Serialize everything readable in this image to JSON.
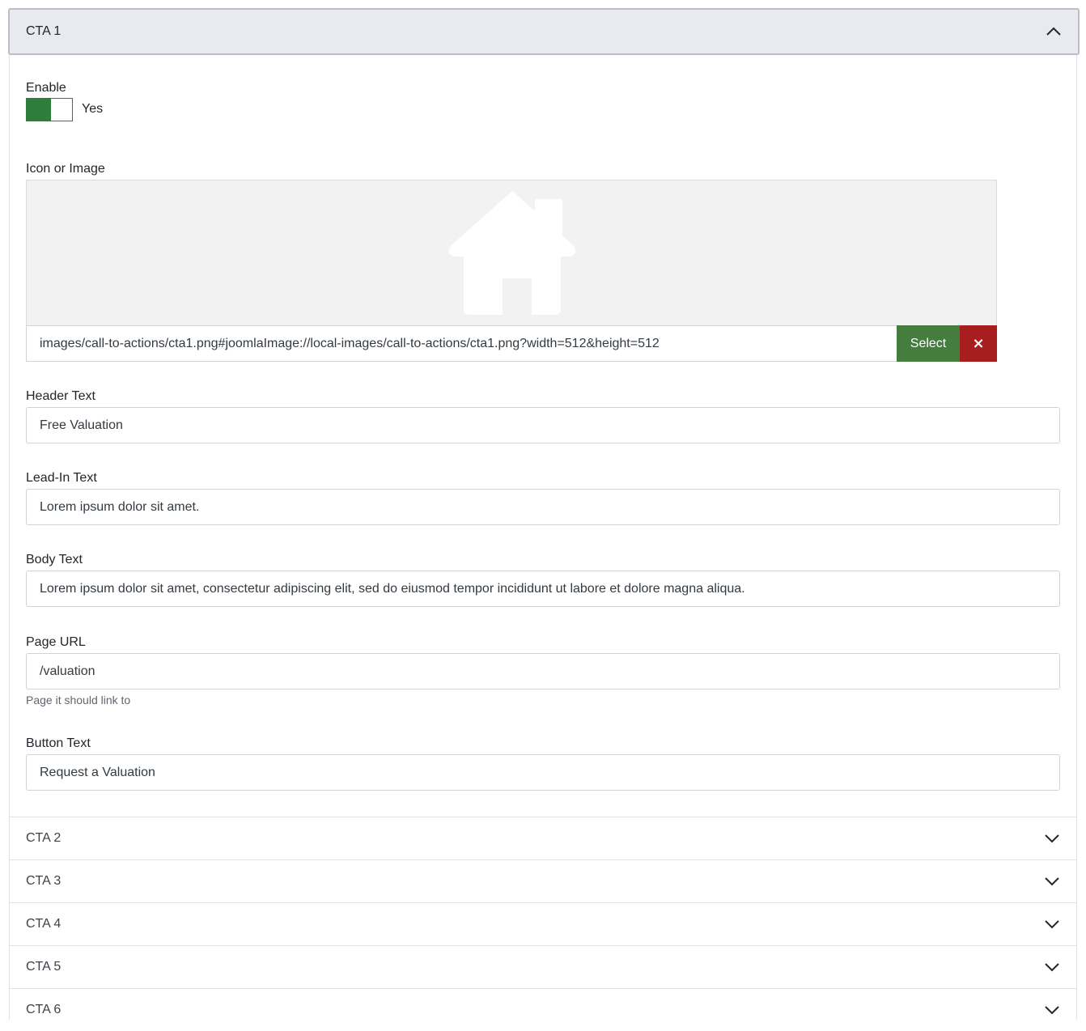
{
  "accordion": {
    "open_panel": {
      "title": "CTA 1",
      "enable": {
        "label": "Enable",
        "state_label": "Yes",
        "enabled": true
      },
      "icon_image": {
        "label": "Icon or Image",
        "preview_icon": "house-icon",
        "value": "images/call-to-actions/cta1.png#joomlaImage://local-images/call-to-actions/cta1.png?width=512&height=512",
        "select_label": "Select",
        "clear_label": "×"
      },
      "header_text": {
        "label": "Header Text",
        "value": "Free Valuation"
      },
      "lead_in_text": {
        "label": "Lead-In Text",
        "value": "Lorem ipsum dolor sit amet."
      },
      "body_text": {
        "label": "Body Text",
        "value": "Lorem ipsum dolor sit amet, consectetur adipiscing elit, sed do eiusmod tempor incididunt ut labore et dolore magna aliqua."
      },
      "page_url": {
        "label": "Page URL",
        "value": "/valuation",
        "help": "Page it should link to"
      },
      "button_text": {
        "label": "Button Text",
        "value": "Request a Valuation"
      }
    },
    "collapsed_panels": [
      {
        "title": "CTA 2"
      },
      {
        "title": "CTA 3"
      },
      {
        "title": "CTA 4"
      },
      {
        "title": "CTA 5"
      },
      {
        "title": "CTA 6"
      }
    ]
  },
  "colors": {
    "toggle_on": "#2f7d3b",
    "select_button": "#457d3f",
    "clear_button": "#a81d1d",
    "header_bg": "#e9eaef"
  }
}
